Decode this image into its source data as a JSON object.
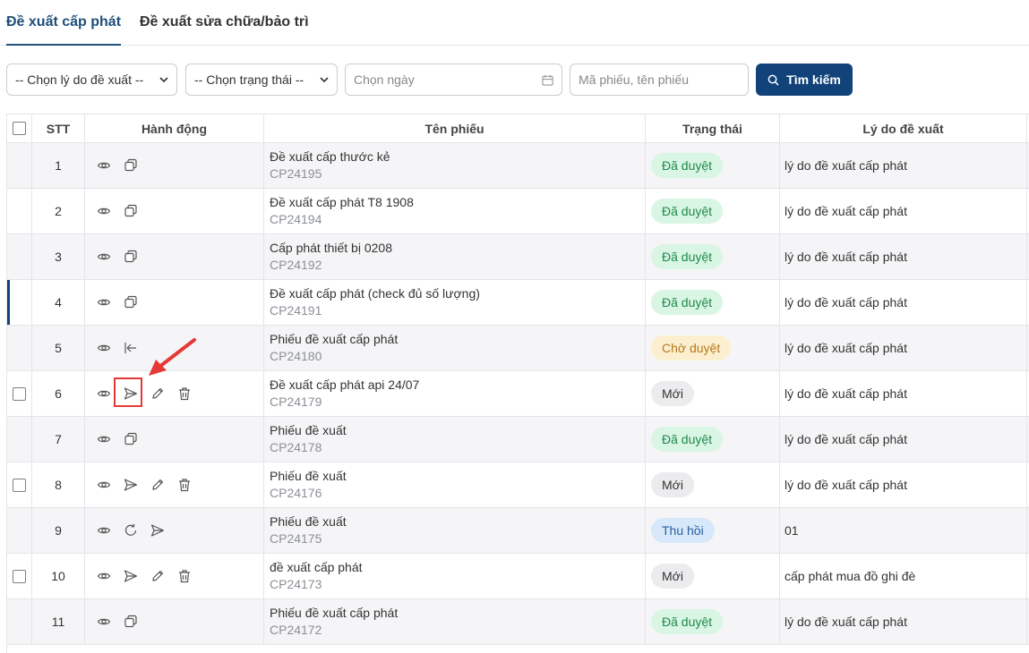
{
  "tabs": [
    {
      "label": "Đề xuất cấp phát"
    },
    {
      "label": "Đề xuất sửa chữa/bảo trì"
    }
  ],
  "filters": {
    "reason_select": "-- Chọn lý do đề xuất --",
    "status_select": "-- Chọn trạng thái --",
    "date_placeholder": "Chọn ngày",
    "keyword_placeholder": "Mã phiếu, tên phiếu",
    "search_button": "Tìm kiếm"
  },
  "columns": {
    "stt": "STT",
    "action": "Hành động",
    "name": "Tên phiếu",
    "status": "Trạng thái",
    "reason": "Lý do đề xuất"
  },
  "rows": [
    {
      "stt": "1",
      "name": "Đề xuất cấp thước kẻ",
      "code": "CP24195",
      "status": "Đã duyệt",
      "reason": "lý do đề xuất cấp phát"
    },
    {
      "stt": "2",
      "name": "Đề xuất cấp phát T8 1908",
      "code": "CP24194",
      "status": "Đã duyệt",
      "reason": "lý do đề xuất cấp phát"
    },
    {
      "stt": "3",
      "name": "Cấp phát thiết bị 0208",
      "code": "CP24192",
      "status": "Đã duyệt",
      "reason": "lý do đề xuất cấp phát"
    },
    {
      "stt": "4",
      "name": "Đề xuất cấp phát (check đủ số lượng)",
      "code": "CP24191",
      "status": "Đã duyệt",
      "reason": "lý do đề xuất cấp phát"
    },
    {
      "stt": "5",
      "name": "Phiếu đề xuất cấp phát",
      "code": "CP24180",
      "status": "Chờ duyệt",
      "reason": "lý do đề xuất cấp phát"
    },
    {
      "stt": "6",
      "name": "Đề xuất cấp phát api 24/07",
      "code": "CP24179",
      "status": "Mới",
      "reason": "lý do đề xuất cấp phát"
    },
    {
      "stt": "7",
      "name": "Phiếu đề xuất",
      "code": "CP24178",
      "status": "Đã duyệt",
      "reason": "lý do đề xuất cấp phát"
    },
    {
      "stt": "8",
      "name": "Phiếu đề xuất",
      "code": "CP24176",
      "status": "Mới",
      "reason": "lý do đề xuất cấp phát"
    },
    {
      "stt": "9",
      "name": "Phiếu đề xuất",
      "code": "CP24175",
      "status": "Thu hồi",
      "reason": "01"
    },
    {
      "stt": "10",
      "name": "đề xuất cấp phát",
      "code": "CP24173",
      "status": "Mới",
      "reason": "cấp phát mua đồ ghi đè"
    },
    {
      "stt": "11",
      "name": "Phiếu đề xuất cấp phát",
      "code": "CP24172",
      "status": "Đã duyệt",
      "reason": "lý do đề xuất cấp phát"
    }
  ],
  "colors": {
    "primary": "#11427a",
    "approved_bg": "#d9f5e3",
    "pending_bg": "#fbefcf",
    "new_bg": "#ececee",
    "recall_bg": "#d7e8fb",
    "highlight": "#e53935"
  }
}
